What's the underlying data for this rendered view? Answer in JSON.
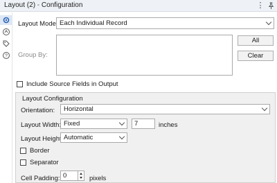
{
  "window": {
    "title": "Layout (2)",
    "separator": " - ",
    "subtitle": "Configuration"
  },
  "layout_mode": {
    "label": "Layout Mode:",
    "value": "Each Individual Record"
  },
  "group_by": {
    "label": "Group By:",
    "all_button": "All",
    "clear_button": "Clear"
  },
  "include_source": {
    "label": "Include Source Fields in Output",
    "checked": false
  },
  "layout_configuration": {
    "title": "Layout Configuration",
    "orientation": {
      "label": "Orientation:",
      "value": "Horizontal"
    },
    "layout_width": {
      "label": "Layout Width:",
      "value": "Fixed",
      "amount": "7",
      "unit": "inches"
    },
    "layout_height": {
      "label": "Layout Height:",
      "value": "Automatic"
    },
    "border": {
      "label": "Border",
      "checked": false
    },
    "separator": {
      "label": "Separator",
      "checked": false
    },
    "cell_padding": {
      "label": "Cell Padding:",
      "value": "0",
      "unit": "pixels"
    }
  },
  "icons": {
    "title_menu": "more-vertical-icon",
    "title_pin": "pin-icon",
    "sidebar": [
      "gear-icon",
      "navigate-icon",
      "tag-icon",
      "help-icon"
    ]
  }
}
